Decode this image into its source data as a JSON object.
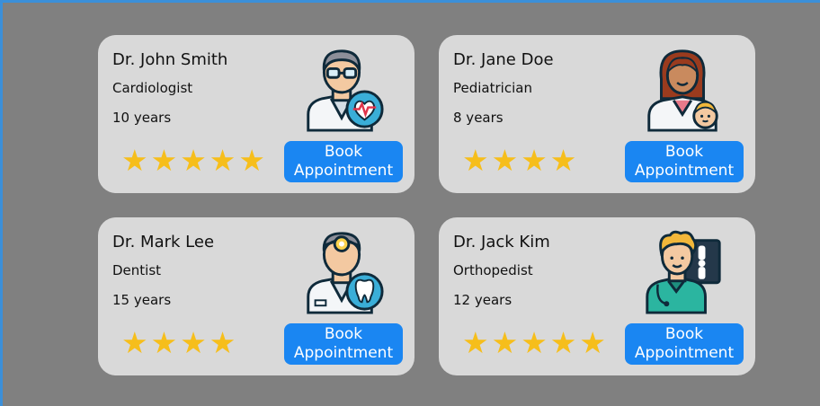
{
  "colors": {
    "background": "#808080",
    "card": "#d9d9d9",
    "button": "#1a86f2",
    "star": "#f6be1b"
  },
  "doctors": [
    {
      "name": "Dr. John Smith",
      "specialty": "Cardiologist",
      "experience": "10 years",
      "rating": 5,
      "icon": "cardiologist-avatar-icon",
      "button": {
        "line1": "Book",
        "line2": "Appointment"
      }
    },
    {
      "name": "Dr. Jane Doe",
      "specialty": "Pediatrician",
      "experience": "8 years",
      "rating": 4,
      "icon": "pediatrician-avatar-icon",
      "button": {
        "line1": "Book",
        "line2": "Appointment"
      }
    },
    {
      "name": "Dr. Mark Lee",
      "specialty": "Dentist",
      "experience": "15 years",
      "rating": 4,
      "icon": "dentist-avatar-icon",
      "button": {
        "line1": "Book",
        "line2": "Appointment"
      }
    },
    {
      "name": "Dr. Jack Kim",
      "specialty": "Orthopedist",
      "experience": "12 years",
      "rating": 5,
      "icon": "orthopedist-avatar-icon",
      "button": {
        "line1": "Book",
        "line2": "Appointment"
      }
    }
  ]
}
